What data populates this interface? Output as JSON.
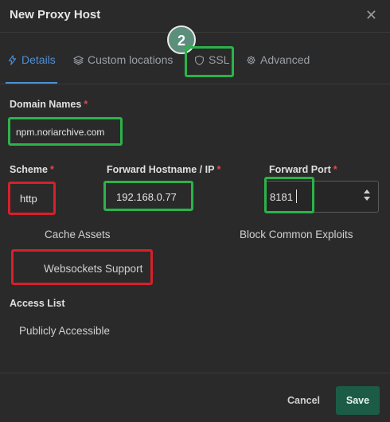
{
  "modal": {
    "title": "New Proxy Host"
  },
  "tabs": [
    {
      "label": "Details",
      "icon": "lightning-icon",
      "active": true
    },
    {
      "label": "Custom locations",
      "icon": "layers-icon",
      "active": false
    },
    {
      "label": "SSL",
      "icon": "shield-icon",
      "active": false
    },
    {
      "label": "Advanced",
      "icon": "gear-icon",
      "active": false
    }
  ],
  "annotation": {
    "step_number": "2",
    "badge_color": "#5b8f7b"
  },
  "form": {
    "domain_names": {
      "label": "Domain Names",
      "required_mark": "*",
      "value": "npm.noriarchive.com"
    },
    "scheme": {
      "label": "Scheme",
      "required_mark": "*",
      "value": "http"
    },
    "forward_host": {
      "label": "Forward Hostname / IP",
      "required_mark": "*",
      "value": "192.168.0.77"
    },
    "forward_port": {
      "label": "Forward Port",
      "required_mark": "*",
      "value": "8181"
    },
    "options": {
      "cache_assets": "Cache Assets",
      "block_exploits": "Block Common Exploits",
      "websockets": "Websockets Support"
    },
    "access_list": {
      "label": "Access List",
      "value": "Publicly Accessible"
    }
  },
  "footer": {
    "cancel_label": "Cancel",
    "save_label": "Save"
  },
  "colors": {
    "accent": "#4f8fd6",
    "save": "#1c5c46",
    "highlight_green": "#2bb34a",
    "highlight_red": "#d91f2a"
  }
}
